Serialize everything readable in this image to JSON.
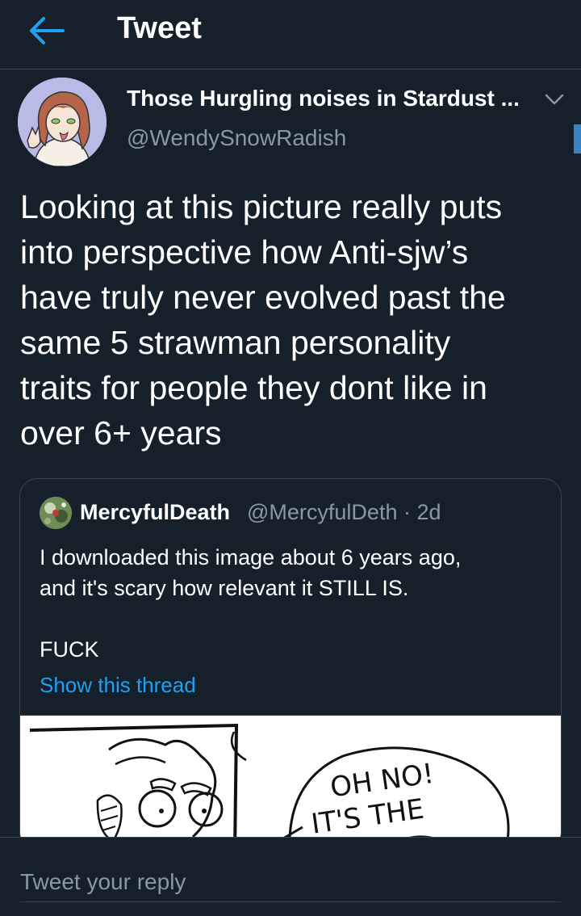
{
  "header": {
    "title": "Tweet",
    "back_icon": "arrow-left-icon"
  },
  "tweet": {
    "display_name": "Those Hurgling noises in Stardust ...",
    "handle": "@WendySnowRadish",
    "menu_icon": "chevron-down-icon",
    "text_lines": [
      "Looking at this picture really puts",
      "into perspective how Anti-sjw’s",
      "have truly never evolved past the",
      "same 5 strawman personality",
      "traits for people they dont like in",
      "over 6+ years"
    ]
  },
  "quoted_tweet": {
    "display_name": "MercyfulDeath",
    "handle_time": "@MercyfulDeth · 2d",
    "text_lines": [
      "I downloaded this image about 6 years ago,",
      "and it's scary how relevant it STILL IS."
    ],
    "text_line_2": "FUCK",
    "show_thread": "Show this thread",
    "image_text": [
      "OH NO!",
      "IT'S THE"
    ]
  },
  "reply": {
    "placeholder": "Tweet your reply"
  },
  "colors": {
    "background": "#15202b",
    "border": "#38444d",
    "secondary_text": "#8899a6",
    "accent": "#1da1f2"
  }
}
